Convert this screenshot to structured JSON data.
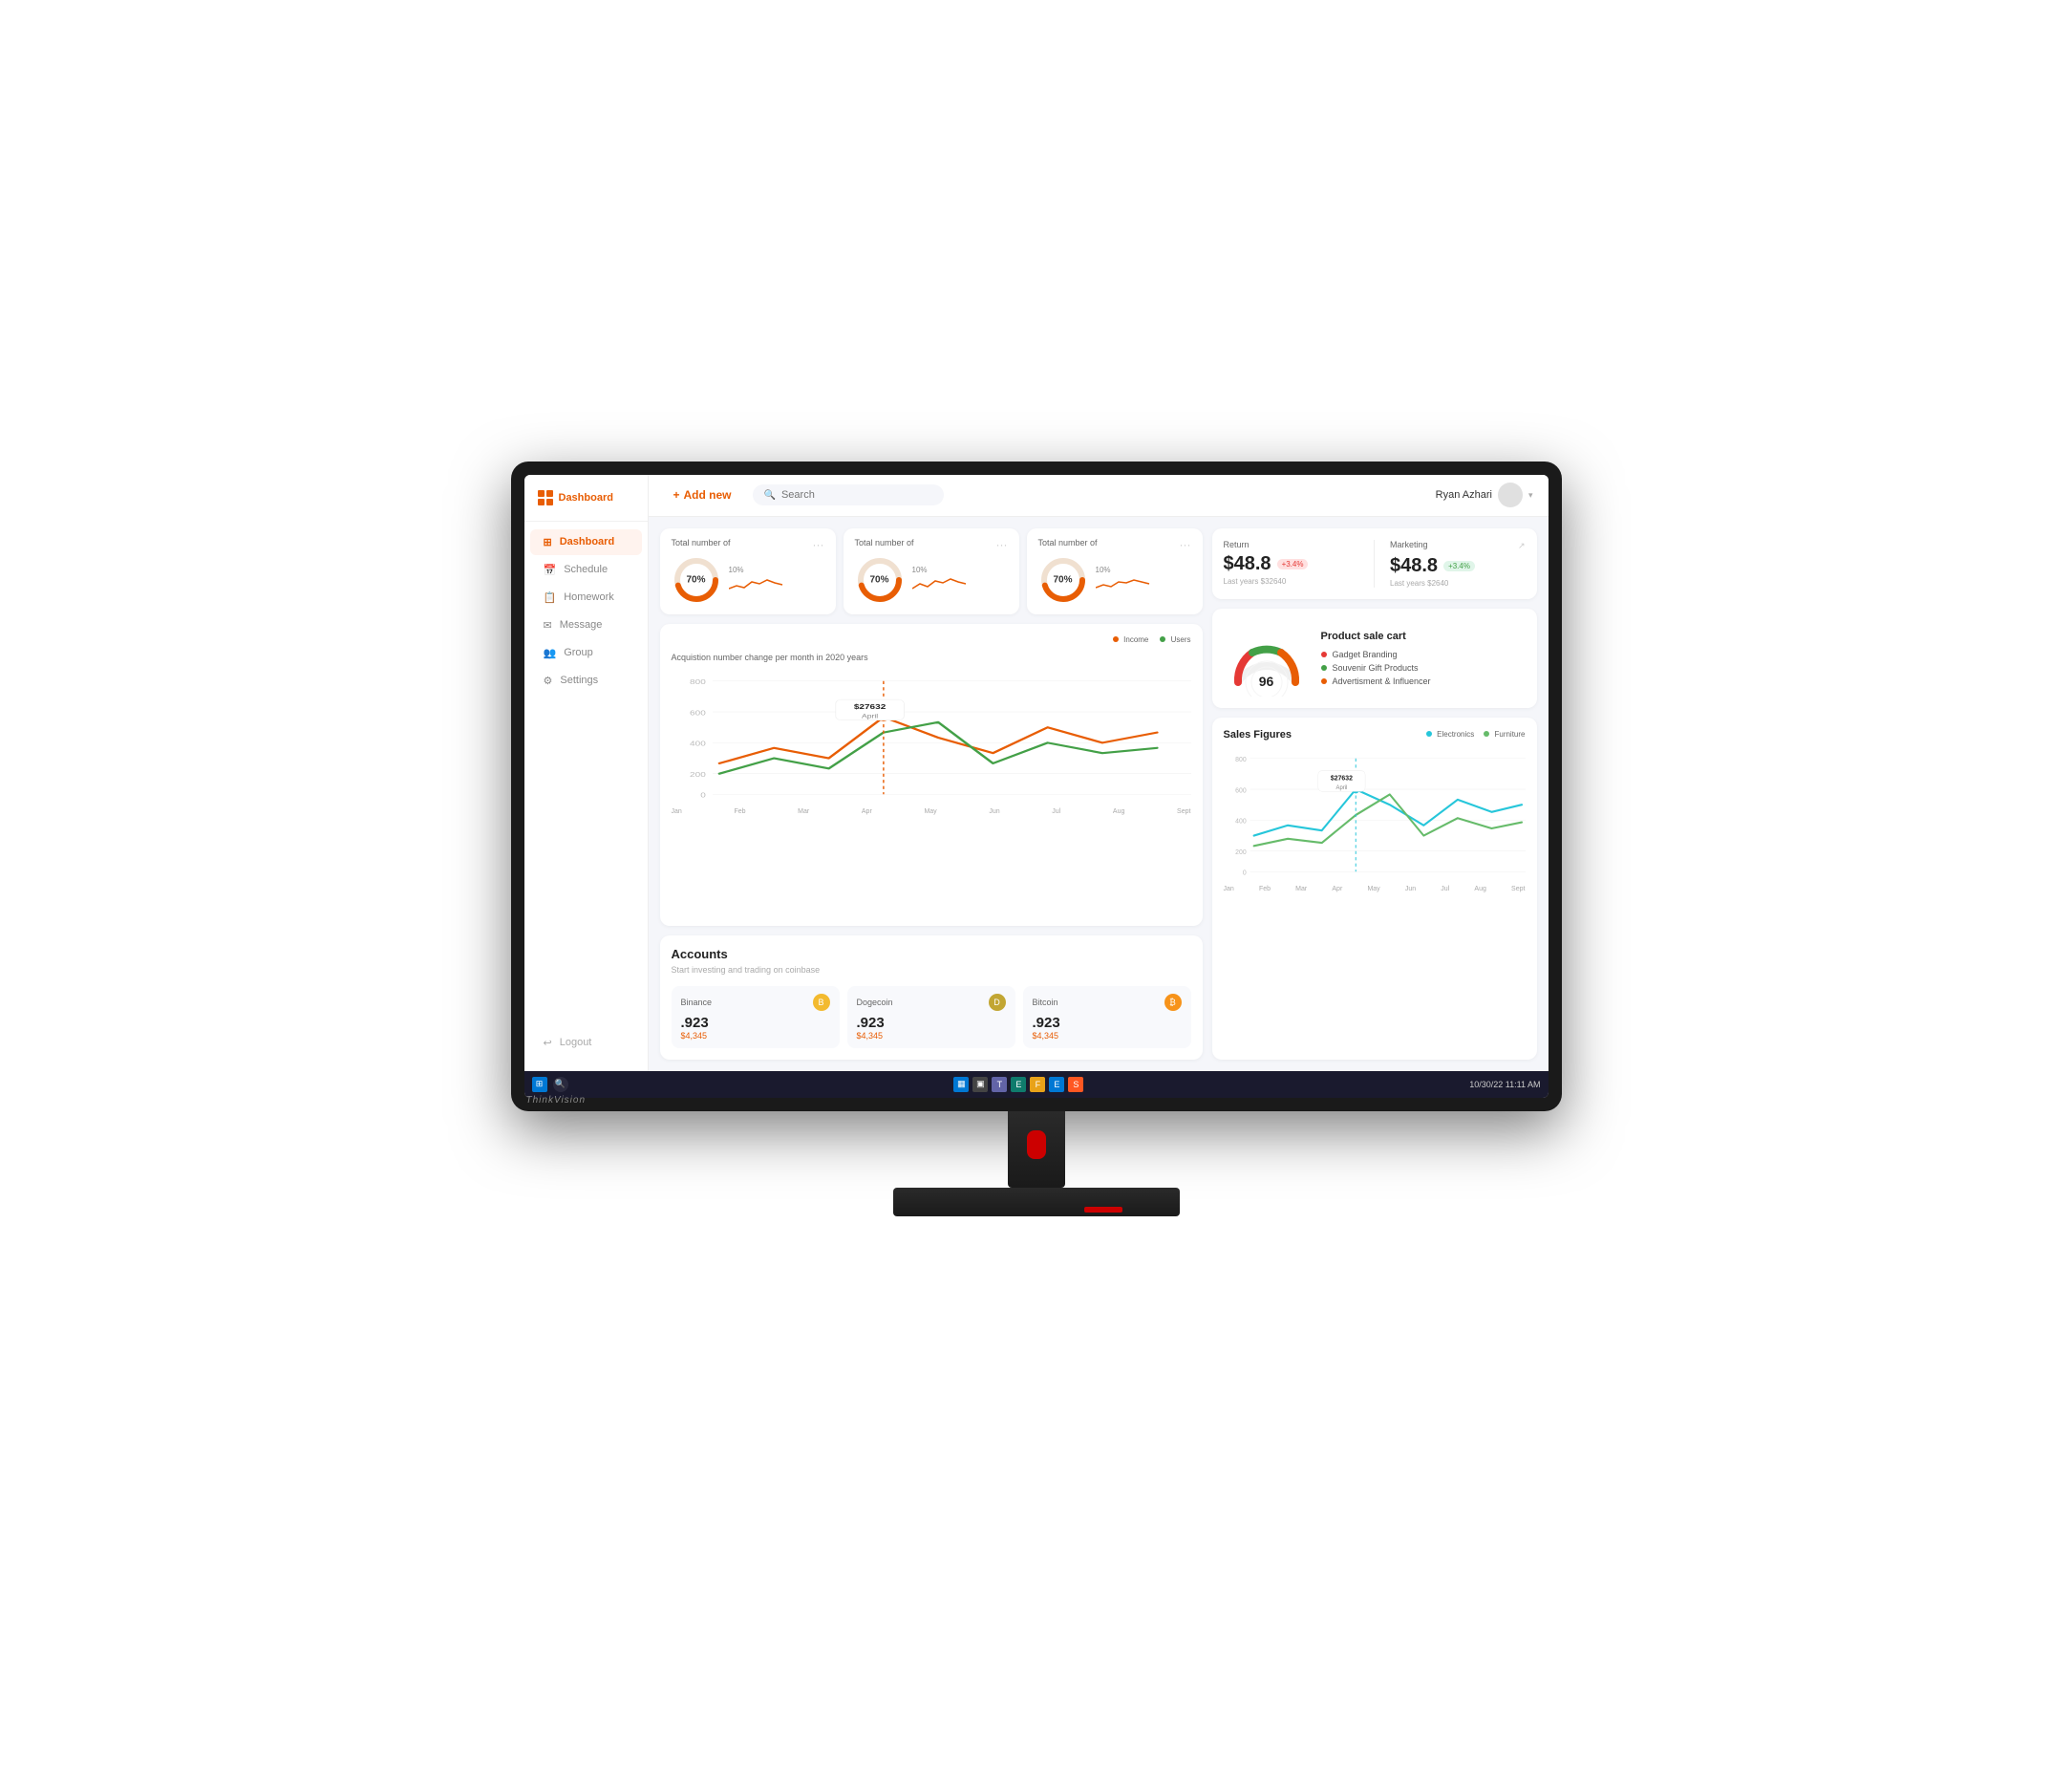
{
  "monitor": {
    "brand": "ThinkVision"
  },
  "taskbar": {
    "time": "11:11 AM",
    "date": "10/30/22"
  },
  "sidebar": {
    "logo_label": "Dashboard",
    "items": [
      {
        "id": "dashboard",
        "label": "Dashboard",
        "icon": "⊞",
        "active": true
      },
      {
        "id": "schedule",
        "label": "Schedule",
        "icon": "📅",
        "active": false
      },
      {
        "id": "homework",
        "label": "Homework",
        "icon": "📋",
        "active": false
      },
      {
        "id": "message",
        "label": "Message",
        "icon": "✉",
        "active": false
      },
      {
        "id": "group",
        "label": "Group",
        "icon": "👥",
        "active": false
      },
      {
        "id": "settings",
        "label": "Settings",
        "icon": "⚙",
        "active": false
      }
    ],
    "logout_label": "Logout"
  },
  "header": {
    "add_new_label": "Add new",
    "search_placeholder": "Search",
    "user_name": "Ryan Azhari"
  },
  "stat_cards": [
    {
      "title": "Total number of",
      "percent": "70%",
      "percent_change": "10%",
      "donut_color": "#e85d04",
      "donut_track": "#f0e0d0"
    },
    {
      "title": "Total number of",
      "percent": "70%",
      "percent_change": "10%",
      "donut_color": "#e85d04",
      "donut_track": "#f0e0d0"
    },
    {
      "title": "Total number of",
      "percent": "70%",
      "percent_change": "10%",
      "donut_color": "#e85d04",
      "donut_track": "#f0e0d0"
    }
  ],
  "acquisition_chart": {
    "title": "Acquistion number change per month in 2020 years",
    "legend": {
      "income_label": "Income",
      "income_color": "#e85d04",
      "users_label": "Users",
      "users_color": "#43a047"
    },
    "tooltip": {
      "value": "$27632",
      "label": "April"
    },
    "y_labels": [
      "800",
      "600",
      "400",
      "200",
      "0"
    ],
    "x_labels": [
      "Jan",
      "Feb",
      "Mar",
      "Apr",
      "May",
      "Jun",
      "Jul",
      "Aug",
      "Sept"
    ]
  },
  "accounts": {
    "title": "Accounts",
    "subtitle": "Start investing and trading on coinbase",
    "crypto": [
      {
        "name": "Binance",
        "value": ".923",
        "price": "$4,345",
        "icon": "B",
        "icon_bg": "#f3ba2f"
      },
      {
        "name": "Dogecoin",
        "value": ".923",
        "price": "$4,345",
        "icon": "D",
        "icon_bg": "#c2a633"
      },
      {
        "name": "Bitcoin",
        "value": ".923",
        "price": "$4,345",
        "icon": "₿",
        "icon_bg": "#f7931a"
      }
    ]
  },
  "return_section": {
    "label": "Return",
    "value": "$48.8",
    "badge": "+3.4%",
    "badge_type": "red",
    "sub": "Last years $32640"
  },
  "marketing_section": {
    "label": "Marketing",
    "value": "$48.8",
    "badge": "+3.4%",
    "badge_type": "green",
    "sub": "Last years $2640"
  },
  "product_sale": {
    "gauge_value": "96",
    "title": "Product sale cart",
    "items": [
      {
        "label": "Gadget Branding",
        "color": "#e53935"
      },
      {
        "label": "Souvenir Gift Products",
        "color": "#43a047"
      },
      {
        "label": "Advertisment & Influencer",
        "color": "#e85d04"
      }
    ]
  },
  "sales_figures": {
    "title": "Sales Figures",
    "legend": [
      {
        "label": "Electronics",
        "color": "#26c6da"
      },
      {
        "label": "Furniture",
        "color": "#66bb6a"
      }
    ],
    "tooltip": {
      "value": "$27632",
      "label": "April"
    },
    "y_labels": [
      "800",
      "600",
      "400",
      "200",
      "0"
    ],
    "x_labels": [
      "Jan",
      "Feb",
      "Mar",
      "Apr",
      "May",
      "Jun",
      "Jul",
      "Aug",
      "Sept"
    ]
  }
}
